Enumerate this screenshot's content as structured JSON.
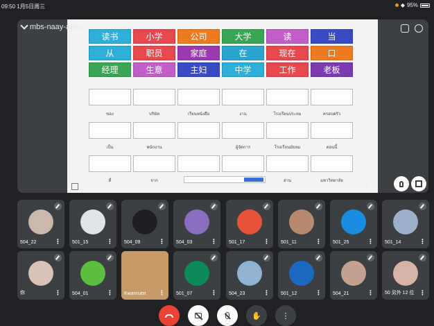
{
  "status_bar": {
    "time": "09:50",
    "date": "1月5日周三",
    "battery": "95%"
  },
  "presentation": {
    "presenter_name": "mbs-naay-aka",
    "colored_grid": [
      {
        "text": "读书",
        "color": "#2db0d8"
      },
      {
        "text": "小学",
        "color": "#e8494f"
      },
      {
        "text": "公司",
        "color": "#ee7c1f"
      },
      {
        "text": "大学",
        "color": "#3aa655"
      },
      {
        "text": "读",
        "color": "#c15fc7"
      },
      {
        "text": "当",
        "color": "#3a4cc3"
      },
      {
        "text": "从",
        "color": "#2db0d8"
      },
      {
        "text": "职员",
        "color": "#e8494f"
      },
      {
        "text": "家庭",
        "color": "#9b3ab0"
      },
      {
        "text": "在",
        "color": "#2aa5cf"
      },
      {
        "text": "现在",
        "color": "#e8494f"
      },
      {
        "text": "口",
        "color": "#ee7c1f"
      },
      {
        "text": "经理",
        "color": "#3aa655"
      },
      {
        "text": "生意",
        "color": "#c15fc7"
      },
      {
        "text": "主妇",
        "color": "#3a4cc3"
      },
      {
        "text": "中学",
        "color": "#2db0d8"
      },
      {
        "text": "工作",
        "color": "#e8494f"
      },
      {
        "text": "老板",
        "color": "#7b3ab0"
      }
    ],
    "thai_rows": [
      [
        "ของ",
        "บริษัท",
        "เรียนหนังสือ",
        "งาน",
        "โรงเรียนประถม",
        "ครอบครัว"
      ],
      [
        "เป็น",
        "พนักงาน",
        "",
        "ผู้จัดการ",
        "โรงเรียนมัธยม",
        "ตอนนี้"
      ],
      [
        "ที่",
        "จาก",
        "",
        "",
        "อ่าน",
        "มหาวิทยาลัย"
      ]
    ],
    "speaker_indicator": "◁) ⠿"
  },
  "participants": [
    {
      "name": "504_22",
      "avatar_color": "#c9b8ab"
    },
    {
      "name": "501_15",
      "avatar_color": "#dfe3e6"
    },
    {
      "name": "504_09",
      "avatar_color": "#1f1f25"
    },
    {
      "name": "504_03",
      "avatar_color": "#8a6fc0"
    },
    {
      "name": "501_17",
      "avatar_color": "#e8523a"
    },
    {
      "name": "501_11",
      "avatar_color": "#b78a6e"
    },
    {
      "name": "501_25",
      "avatar_color": "#1a8ce0"
    },
    {
      "name": "501_14",
      "avatar_color": "#9eb0c9"
    },
    {
      "name": "你",
      "avatar_color": "#d9c2b8"
    },
    {
      "name": "504_01",
      "avatar_color": "#5cbf3e"
    },
    {
      "name": "Kwanruen",
      "avatar_color": "#c79a6a"
    },
    {
      "name": "501_07",
      "avatar_color": "#0d8a5a"
    },
    {
      "name": "504_23",
      "avatar_color": "#8fb3d1"
    },
    {
      "name": "501_12",
      "avatar_color": "#1a68c0"
    },
    {
      "name": "504_21",
      "avatar_color": "#c4a18e"
    },
    {
      "name": "50  另外 12 位",
      "avatar_color": "#d7b3a6"
    }
  ],
  "controls": {
    "end_call_icon": "phone-hangup-icon",
    "camera_icon": "camera-off-icon",
    "mic_icon": "mic-off-icon",
    "raise_hand_icon": "hand-icon",
    "more_icon": "more-vert-icon",
    "more_label": "⋮",
    "hand_label": "✋",
    "more_dots": "⋮"
  }
}
